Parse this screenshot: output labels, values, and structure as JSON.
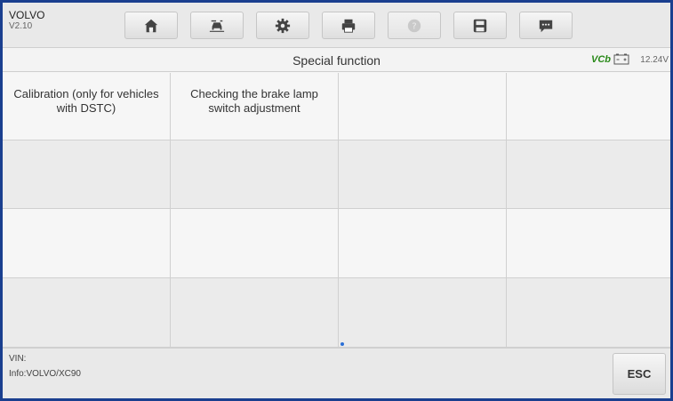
{
  "header": {
    "make": "VOLVO",
    "version": "V2.10"
  },
  "toolbar": {
    "buttons": [
      {
        "icon": "home-icon"
      },
      {
        "icon": "vehicle-swap-icon"
      },
      {
        "icon": "gear-icon"
      },
      {
        "icon": "print-icon"
      },
      {
        "icon": "help-icon"
      },
      {
        "icon": "save-icon"
      },
      {
        "icon": "message-icon"
      }
    ]
  },
  "titlebar": {
    "title": "Special function",
    "vci_label": "VCb",
    "voltage": "12.24V"
  },
  "grid": {
    "cells": [
      "Calibration (only for vehicles with DSTC)",
      "Checking the brake lamp switch adjustment",
      "",
      "",
      "",
      "",
      "",
      "",
      "",
      "",
      "",
      "",
      "",
      "",
      "",
      ""
    ]
  },
  "footer": {
    "vin_label": "VIN:",
    "info": "Info:VOLVO/XC90",
    "esc_label": "ESC"
  },
  "colors": {
    "frame": "#1a3f8f",
    "vcb": "#2a8a1a",
    "icon": "#444444"
  }
}
